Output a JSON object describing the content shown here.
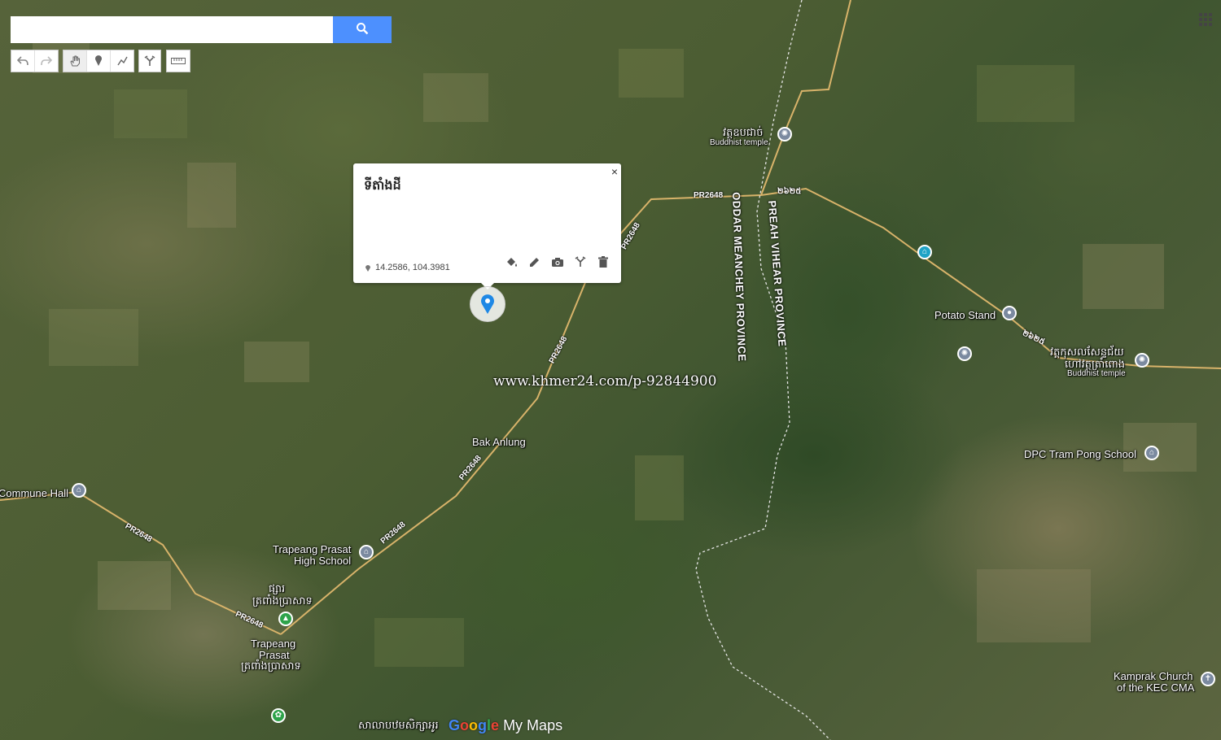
{
  "search": {
    "placeholder": "",
    "value": ""
  },
  "toolbar": {
    "undo": "undo-icon",
    "redo": "redo-icon",
    "pan": "hand-icon",
    "marker": "marker-icon",
    "line": "draw-line-icon",
    "directions": "directions-icon",
    "measure": "ruler-icon"
  },
  "popup": {
    "title": "ទីតាំងដី",
    "coords": "14.2586, 104.3981",
    "close": "×",
    "actions": [
      "paint-bucket-icon",
      "pencil-icon",
      "camera-icon",
      "directions-icon",
      "trash-icon"
    ]
  },
  "watermark": "www.khmer24.com/p-92844900",
  "places": {
    "temple_top": "វត្តឧបជាច់",
    "temple_top_sub": "Buddhist temple",
    "potato_stand": "Potato Stand",
    "temple_right": "វត្តកុសលសែន្ទជ័យ",
    "temple_right2": "ហៅវត្តត្រាំពោង",
    "temple_right_sub": "Buddhist temple",
    "dpc_school": "DPC Tram Pong School",
    "bak_anlung": "Bak Anlung",
    "commune_hall": "Commune Hall",
    "tp_high_school_1": "Trapeang Prasat",
    "tp_high_school_2": "High School",
    "tp_market_kh1": "ផ្សារ",
    "tp_market_kh2": "ត្រពាំងប្រាសាទ",
    "tp_town_1": "Trapeang",
    "tp_town_2": "Prasat",
    "tp_town_kh": "ត្រពាំងប្រាសាទ",
    "kamprak_1": "Kamprak Church",
    "kamprak_2": "of the KEC CMA",
    "bottom_school": "សាលាបឋមសិក្សាអូរ"
  },
  "roads": {
    "pr2648": "PR2648",
    "kh_road": "២៦២៥"
  },
  "provinces": {
    "oddar": "ODDAR MEANCHEY PROVINCE",
    "preah": "PREAH VIHEAR PROVINCE"
  },
  "logo": {
    "google": "Google",
    "mymaps": "My Maps"
  },
  "colors": {
    "search_button": "#4d90fe",
    "marker": "#1e88e5",
    "road": "#d8b36a"
  }
}
